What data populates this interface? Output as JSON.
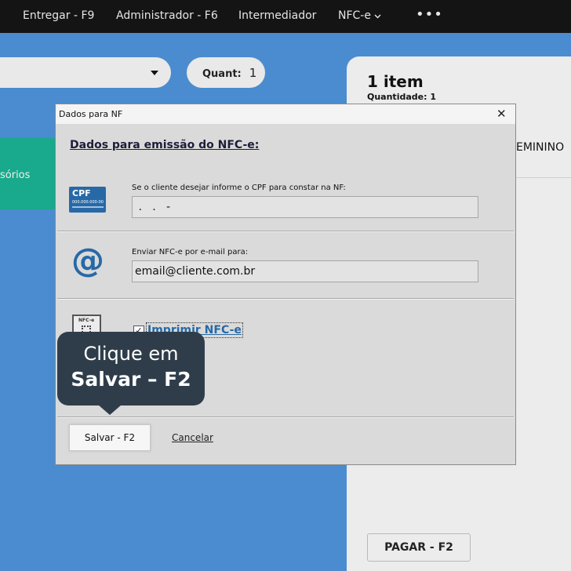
{
  "nav": {
    "items": [
      "Entregar - F9",
      "Administrador - F6",
      "Intermediador",
      "NFC-e"
    ],
    "more": "•••"
  },
  "background": {
    "quant_label": "Quant:",
    "quant_value": "1",
    "category_partial": "sórios",
    "cart_title": "1 item",
    "cart_quantity": "Quantidade: 1",
    "cart_product_partial": "EMININO",
    "pay_button": "PAGAR - F2"
  },
  "dialog": {
    "title": "Dados para NF",
    "close_glyph": "✕",
    "heading": "Dados para emissão do NFC-e:",
    "cpf_icon_text": "CPF",
    "cpf_icon_number": "000.000.000-00",
    "cpf_label": "Se o cliente desejar informe o CPF para constar na NF:",
    "cpf_value": " .   .   -",
    "email_label": "Enviar NFC-e por e-mail para:",
    "email_value": "email@cliente.com.br",
    "nfce_icon_text": "NFC-e",
    "print_label": "Imprimir NFC-e",
    "print_checked": true,
    "save_button": "Salvar - F2",
    "cancel_link": "Cancelar"
  },
  "tooltip": {
    "line1": "Clique em",
    "line2": "Salvar – F2"
  },
  "colors": {
    "background_blue": "#4a8ccf",
    "topbar": "#141414",
    "accent_green": "#19a98c",
    "icon_blue": "#2769a6",
    "tooltip_bg": "#2f3d4b"
  }
}
